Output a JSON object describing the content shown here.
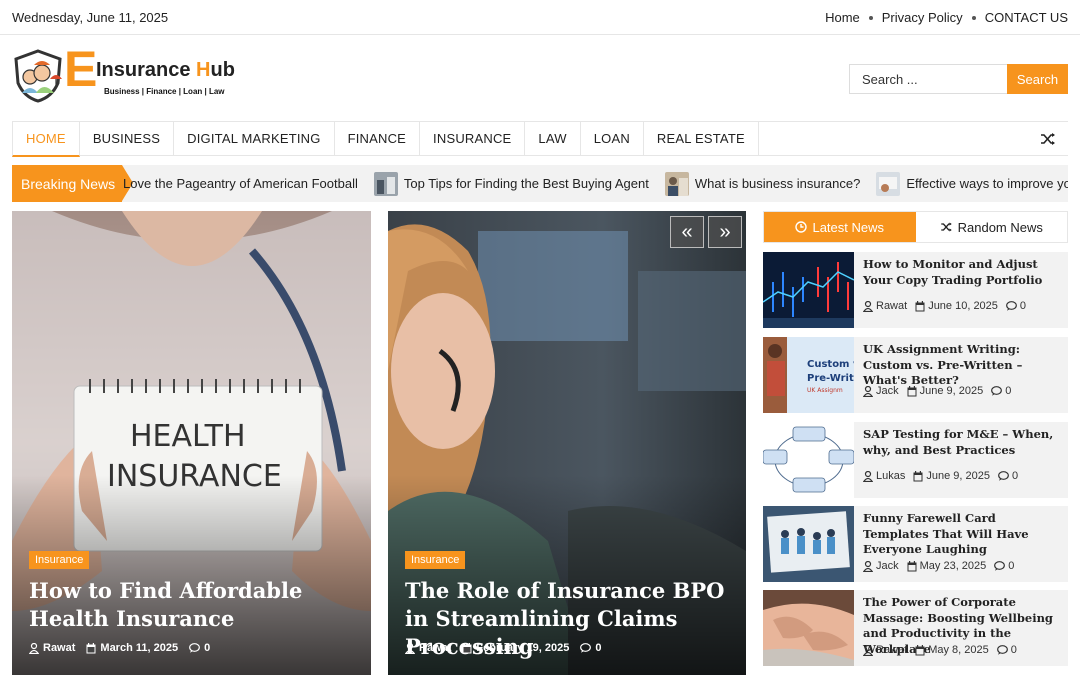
{
  "topbar": {
    "date": "Wednesday, June 11, 2025",
    "links": [
      "Home",
      "Privacy Policy",
      "CONTACT US"
    ]
  },
  "logo": {
    "letter": "E",
    "brand_start": "Insurance ",
    "brand_h": "H",
    "brand_end": "ub",
    "tagline": "Business | Finance | Loan | Law"
  },
  "search": {
    "placeholder": "Search ...",
    "button": "Search"
  },
  "nav": {
    "items": [
      "HOME",
      "BUSINESS",
      "DIGITAL MARKETING",
      "FINANCE",
      "INSURANCE",
      "LAW",
      "LOAN",
      "REAL ESTATE"
    ],
    "shuffle_icon": "shuffle-icon"
  },
  "breaking": {
    "label": "Breaking News",
    "items": [
      "Love the Pageantry of American Football",
      "Top Tips for Finding the Best Buying Agent",
      "What is business insurance?",
      "Effective ways to improve your business!"
    ]
  },
  "hero": [
    {
      "category": "Insurance",
      "title": "How to Find Affordable Health Insurance",
      "author": "Rawat",
      "date": "March 11, 2025",
      "comments": "0",
      "sign_line1": "HEALTH",
      "sign_line2": "INSURANCE"
    },
    {
      "category": "Insurance",
      "title": "The Role of Insurance BPO in Streamlining Claims Processing",
      "author": "Rawat",
      "date": "February 19, 2025",
      "comments": "0"
    }
  ],
  "slider": {
    "prev": "«",
    "next": "»"
  },
  "sidebar": {
    "tabs": [
      "Latest News",
      "Random News"
    ],
    "news": [
      {
        "title": "How to Monitor and Adjust Your Copy Trading Portfolio",
        "author": "Rawat",
        "date": "June 10, 2025",
        "comments": "0"
      },
      {
        "title": "UK Assignment Writing: Custom vs. Pre-Written – What's Better?",
        "author": "Jack",
        "date": "June 9, 2025",
        "comments": "0",
        "img_text1": "Custom v",
        "img_text2": "Pre-Writ",
        "img_text3": "UK Assignm"
      },
      {
        "title": "SAP Testing for M&E – When, why, and Best Practices",
        "author": "Lukas",
        "date": "June 9, 2025",
        "comments": "0"
      },
      {
        "title": "Funny Farewell Card Templates That Will Have Everyone Laughing",
        "author": "Jack",
        "date": "May 23, 2025",
        "comments": "0"
      },
      {
        "title": "The Power of Corporate Massage: Boosting Wellbeing and Productivity in the Workplace",
        "author": "Rawat",
        "date": "May 8, 2025",
        "comments": "0"
      }
    ]
  },
  "colors": {
    "accent": "#f7941d",
    "panel": "#f2f2f2"
  }
}
